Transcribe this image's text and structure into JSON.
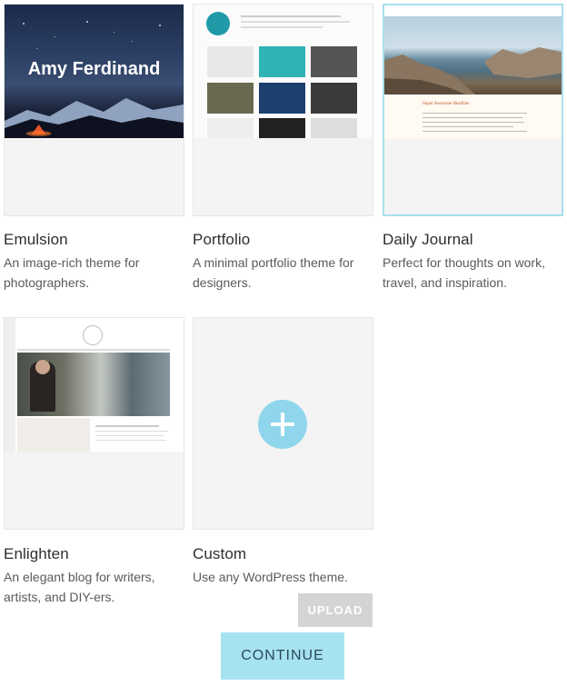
{
  "themes": [
    {
      "name": "Emulsion",
      "description": "An image-rich theme for photographers.",
      "preview_title": "Amy Ferdinand"
    },
    {
      "name": "Portfolio",
      "description": "A minimal portfolio theme for designers."
    },
    {
      "name": "Daily Journal",
      "description": "Perfect for thoughts on work, travel, and inspiration.",
      "preview_headline": "Super Awesome Headline"
    },
    {
      "name": "Enlighten",
      "description": "An elegant blog for writers, artists, and DIY-ers."
    },
    {
      "name": "Custom",
      "description": "Use any WordPress theme."
    }
  ],
  "upload_label": "UPLOAD",
  "continue_label": "CONTINUE",
  "colors": {
    "accent": "#a6e2f0",
    "plus": "#8fd6ec",
    "selected_border": "#a7e0ee",
    "upload_bg": "#d4d4d4"
  }
}
